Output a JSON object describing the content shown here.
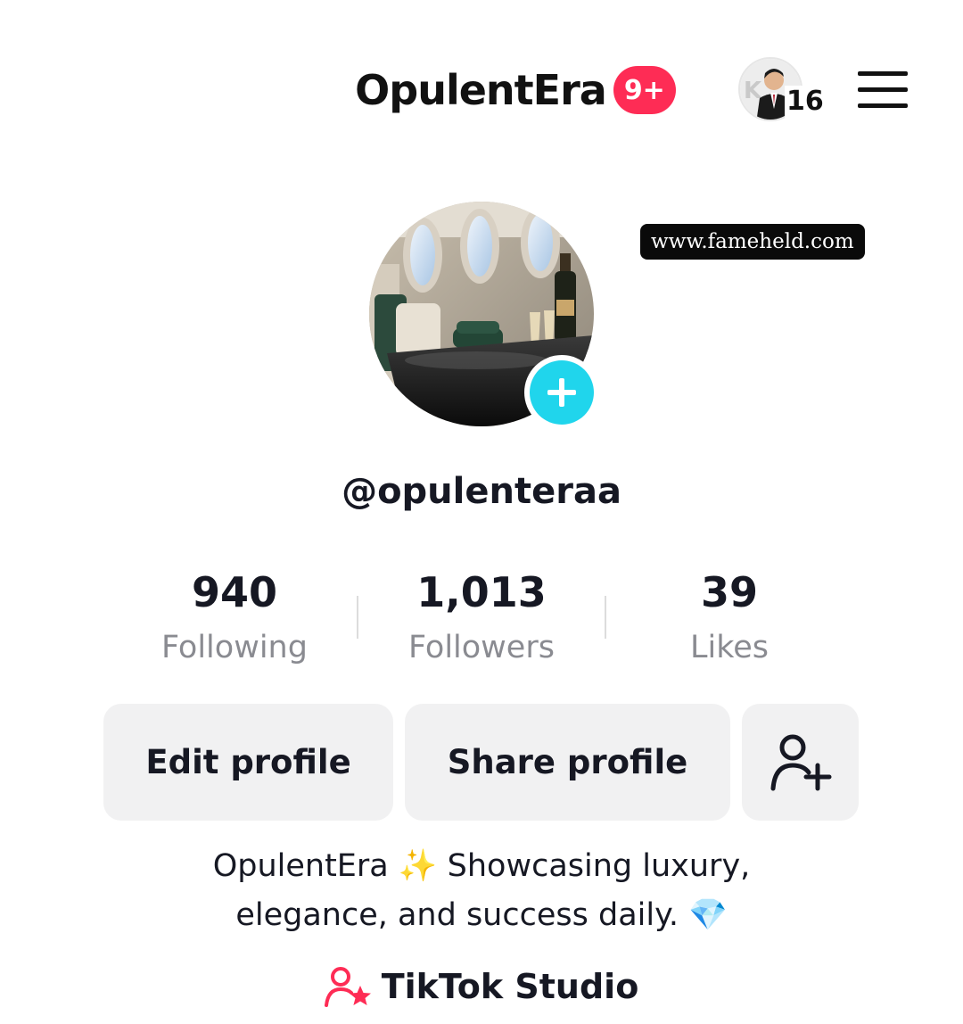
{
  "header": {
    "title": "OpulentEra",
    "notification_badge": "9+",
    "story_count": "16",
    "menu_icon": "hamburger-menu-icon"
  },
  "profile": {
    "avatar_icon": "add-photo-plus-icon",
    "watermark": "www.fameheld.com",
    "handle": "@opulenteraa"
  },
  "stats": [
    {
      "value": "940",
      "label": "Following"
    },
    {
      "value": "1,013",
      "label": "Followers"
    },
    {
      "value": "39",
      "label": "Likes"
    }
  ],
  "actions": {
    "edit_label": "Edit profile",
    "share_label": "Share profile",
    "add_friend_icon": "add-friend-icon"
  },
  "bio": {
    "line1_text": "OpulentEra",
    "line1_emoji": "✨",
    "line1_rest": "Showcasing luxury,",
    "line2_text": "elegance, and success daily.",
    "line2_emoji": "💎"
  },
  "studio": {
    "label": "TikTok Studio",
    "icon": "creator-star-icon"
  },
  "colors": {
    "badge": "#fe2c55",
    "add_button": "#20d5ec",
    "secondary_text": "#8a8b91",
    "button_bg": "#f1f1f2"
  }
}
